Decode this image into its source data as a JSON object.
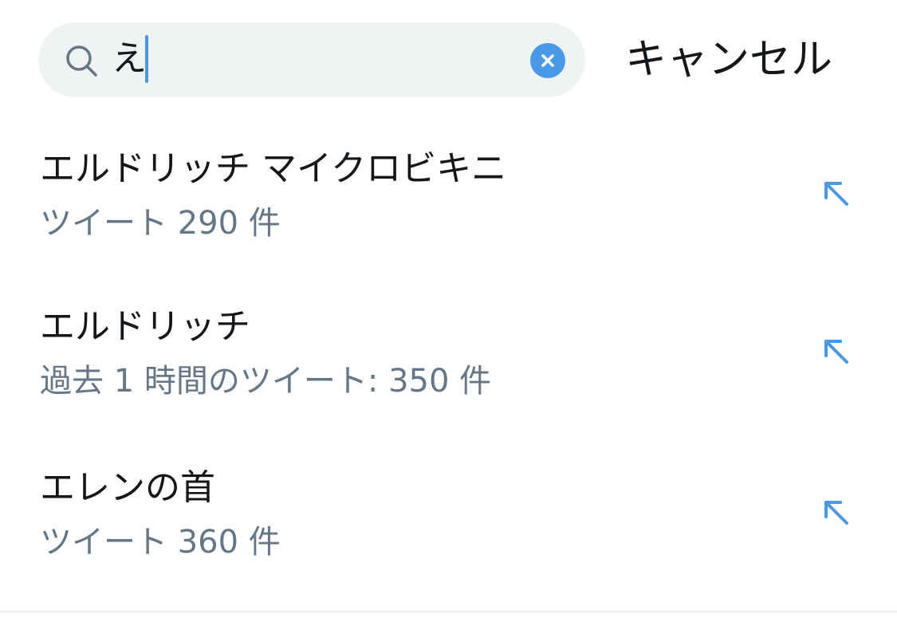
{
  "search": {
    "query": "え",
    "cancel_label": "キャンセル"
  },
  "colors": {
    "accent": "#4a99e9",
    "search_bg": "#eff3f4",
    "primary_text": "#14171a",
    "secondary_text": "#657786"
  },
  "suggestions": [
    {
      "title": "エルドリッチ マイクロビキニ",
      "subtitle": "ツイート 290 件",
      "icon": "arrow-up-left-icon"
    },
    {
      "title": "エルドリッチ",
      "subtitle": "過去 1 時間のツイート: 350 件",
      "icon": "arrow-up-left-icon"
    },
    {
      "title": "エレンの首",
      "subtitle": "ツイート 360 件",
      "icon": "arrow-up-left-icon"
    }
  ]
}
